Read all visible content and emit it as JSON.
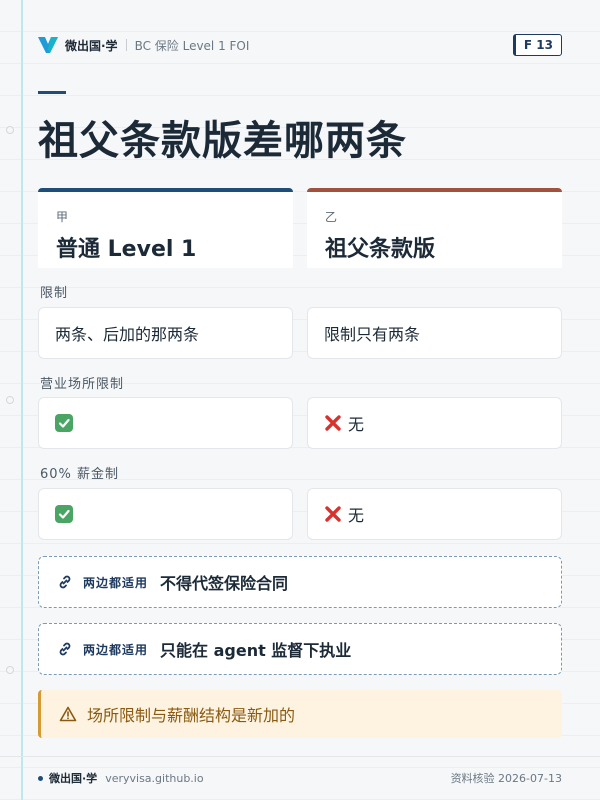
{
  "header": {
    "brand": "微出国·学",
    "subtitle": "BC 保险 Level 1 FOI",
    "badge": "F 13"
  },
  "title": "祖父条款版差哪两条",
  "columns": [
    {
      "tag": "甲",
      "name": "普通 Level 1"
    },
    {
      "tag": "乙",
      "name": "祖父条款版"
    }
  ],
  "rows": [
    {
      "label": "限制",
      "left": "两条、后加的那两条",
      "right": "限制只有两条"
    },
    {
      "label": "营业场所限制",
      "left_icon": "check-icon",
      "right_icon": "cross-icon",
      "right": "无"
    },
    {
      "label": "60% 薪金制",
      "left_icon": "check-icon",
      "right_icon": "cross-icon",
      "right": "无"
    }
  ],
  "both": [
    {
      "icon": "link-icon",
      "tag": "两边都适用",
      "text": "不得代签保险合同"
    },
    {
      "icon": "link-icon",
      "tag": "两边都适用",
      "text": "只能在 agent 监督下执业"
    }
  ],
  "warning": {
    "icon": "warning-icon",
    "text": "场所限制与薪酬结构是新加的"
  },
  "footer": {
    "brand": "微出国·学",
    "url": "veryvisa.github.io",
    "right": "资料核验 2026-07-13"
  },
  "colors": {
    "accent_blue": "#1e4d7a",
    "accent_red": "#a0523f",
    "check_green": "#4aa564",
    "cross_red": "#d8322f",
    "warn_bg": "#fdf3e0"
  }
}
